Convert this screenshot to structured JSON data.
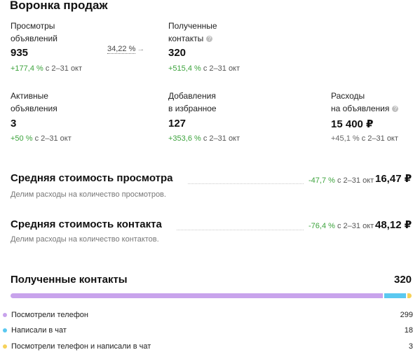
{
  "title": "Воронка продаж",
  "metrics": {
    "views": {
      "label1": "Просмотры",
      "label2": "объявлений",
      "value": "935",
      "delta": "+177,4 %",
      "period": "с 2–31 окт"
    },
    "conversion": {
      "value": "34,22 %",
      "arrow": "→"
    },
    "contacts": {
      "label1": "Полученные",
      "label2": "контакты",
      "value": "320",
      "delta": "+515,4 %",
      "period": "с 2–31 окт"
    },
    "active": {
      "label1": "Активные",
      "label2": "объявления",
      "value": "3",
      "delta": "+50 %",
      "period": "с 2–31 окт"
    },
    "favorites": {
      "label1": "Добавления",
      "label2": "в избранное",
      "value": "127",
      "delta": "+353,6 %",
      "period": "с 2–31 окт"
    },
    "expenses": {
      "label1": "Расходы",
      "label2": "на объявления",
      "value": "15 400 ₽",
      "delta": "+45,1 %",
      "period": "с 2–31 окт"
    }
  },
  "avg_view": {
    "title": "Средняя стоимость просмотра",
    "delta": "-47,7 %",
    "period": "с 2–31 окт",
    "value": "16,47 ₽",
    "desc": "Делим расходы на количество просмотров."
  },
  "avg_contact": {
    "title": "Средняя стоимость контакта",
    "delta": "-76,4 %",
    "period": "с 2–31 окт",
    "value": "48,12 ₽",
    "desc": "Делим расходы на количество контактов."
  },
  "contacts_breakdown": {
    "title": "Полученные контакты",
    "total": "320",
    "items": [
      {
        "label": "Посмотрели телефон",
        "value": "299",
        "color": "#c8a3ec"
      },
      {
        "label": "Написали в чат",
        "value": "18",
        "color": "#5ac8f0"
      },
      {
        "label": "Посмотрели телефон и написали в чат",
        "value": "3",
        "color": "#f6d25a"
      }
    ],
    "shares": [
      0.934,
      0.056,
      0.01
    ]
  },
  "icons": {
    "help": "?"
  }
}
